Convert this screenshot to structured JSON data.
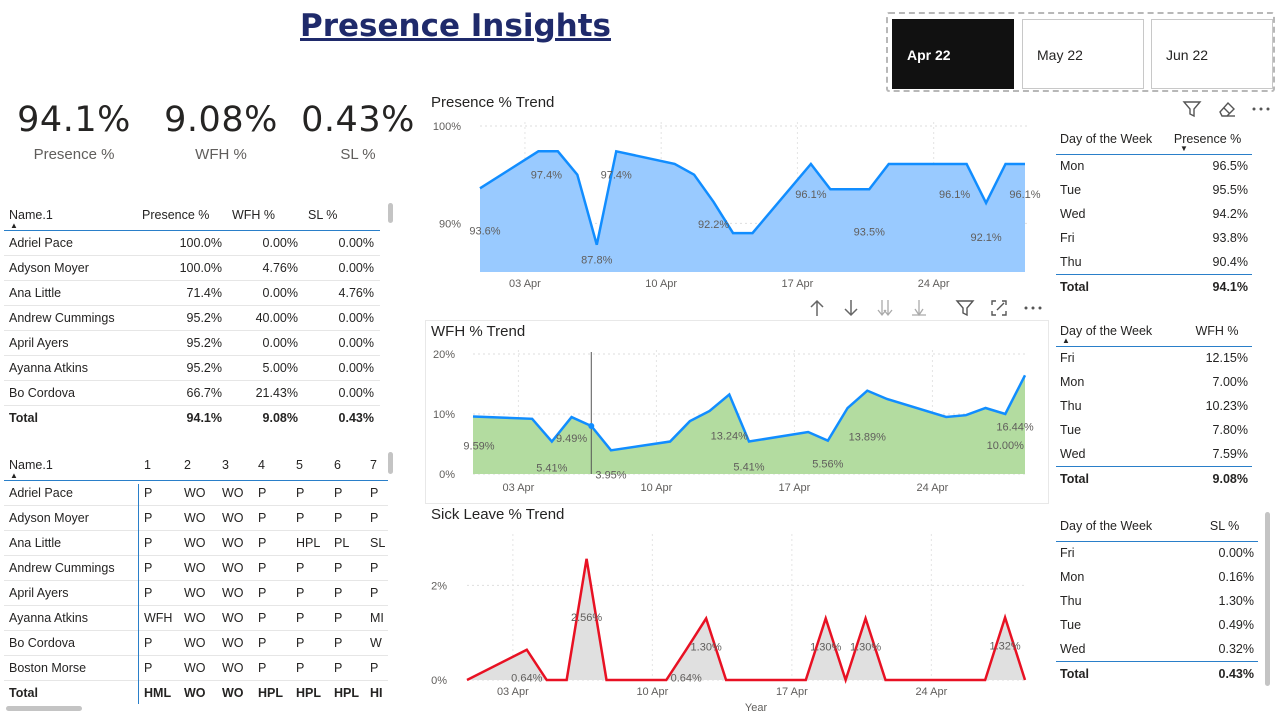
{
  "title": "Presence Insights",
  "slicer": {
    "items": [
      "Apr 22",
      "May 22",
      "Jun 22"
    ],
    "selected": "Apr 22"
  },
  "kpis": [
    {
      "value": "94.1%",
      "label": "Presence %"
    },
    {
      "value": "9.08%",
      "label": "WFH %"
    },
    {
      "value": "0.43%",
      "label": "SL %"
    }
  ],
  "employee_table": {
    "headers": [
      "Name.1",
      "Presence %",
      "WFH %",
      "SL %"
    ],
    "rows": [
      [
        "Adriel Pace",
        "100.0%",
        "0.00%",
        "0.00%"
      ],
      [
        "Adyson Moyer",
        "100.0%",
        "4.76%",
        "0.00%"
      ],
      [
        "Ana Little",
        "71.4%",
        "0.00%",
        "4.76%"
      ],
      [
        "Andrew Cummings",
        "95.2%",
        "40.00%",
        "0.00%"
      ],
      [
        "April Ayers",
        "95.2%",
        "0.00%",
        "0.00%"
      ],
      [
        "Ayanna Atkins",
        "95.2%",
        "5.00%",
        "0.00%"
      ],
      [
        "Bo Cordova",
        "66.7%",
        "21.43%",
        "0.00%"
      ]
    ],
    "total": [
      "Total",
      "94.1%",
      "9.08%",
      "0.43%"
    ]
  },
  "matrix_table": {
    "headers": [
      "Name.1",
      "1",
      "2",
      "3",
      "4",
      "5",
      "6",
      "7"
    ],
    "rows": [
      [
        "Adriel Pace",
        "P",
        "WO",
        "WO",
        "P",
        "P",
        "P",
        "P"
      ],
      [
        "Adyson Moyer",
        "P",
        "WO",
        "WO",
        "P",
        "P",
        "P",
        "P"
      ],
      [
        "Ana Little",
        "P",
        "WO",
        "WO",
        "P",
        "HPL",
        "PL",
        "SL"
      ],
      [
        "Andrew Cummings",
        "P",
        "WO",
        "WO",
        "P",
        "P",
        "P",
        "P"
      ],
      [
        "April Ayers",
        "P",
        "WO",
        "WO",
        "P",
        "P",
        "P",
        "P"
      ],
      [
        "Ayanna Atkins",
        "WFH",
        "WO",
        "WO",
        "P",
        "P",
        "P",
        "MI"
      ],
      [
        "Bo Cordova",
        "P",
        "WO",
        "WO",
        "P",
        "P",
        "P",
        "W"
      ],
      [
        "Boston Morse",
        "P",
        "WO",
        "WO",
        "P",
        "P",
        "P",
        "P"
      ]
    ],
    "total": [
      "Total",
      "HML",
      "WO",
      "WO",
      "HPL",
      "HPL",
      "HPL",
      "HI"
    ]
  },
  "presence_trend": {
    "title": "Presence % Trend",
    "y_ticks": [
      "100%",
      "90%"
    ],
    "x_ticks": [
      "03 Apr",
      "10 Apr",
      "17 Apr",
      "24 Apr"
    ],
    "labels": [
      "93.6%",
      "97.4%",
      "97.4%",
      "87.8%",
      "92.2%",
      "96.1%",
      "93.5%",
      "96.1%",
      "92.1%",
      "96.1%"
    ]
  },
  "wfh_trend": {
    "title": "WFH % Trend",
    "y_ticks": [
      "20%",
      "10%",
      "0%"
    ],
    "x_ticks": [
      "03 Apr",
      "10 Apr",
      "17 Apr",
      "24 Apr"
    ],
    "labels": [
      "9.59%",
      "5.41%",
      "9.49%",
      "3.95%",
      "13.24%",
      "5.41%",
      "5.56%",
      "13.89%",
      "10.00%",
      "16.44%"
    ]
  },
  "sl_trend": {
    "title": "Sick Leave % Trend",
    "y_ticks": [
      "2%",
      "0%"
    ],
    "x_ticks": [
      "03 Apr",
      "10 Apr",
      "17 Apr",
      "24 Apr"
    ],
    "x_axis_label": "Year",
    "labels": [
      "0.64%",
      "2.56%",
      "0.64%",
      "1.30%",
      "1.30%",
      "1.30%",
      "1.32%"
    ]
  },
  "presence_by_day": {
    "headers": [
      "Day of the Week",
      "Presence %"
    ],
    "rows": [
      [
        "Mon",
        "96.5%"
      ],
      [
        "Tue",
        "95.5%"
      ],
      [
        "Wed",
        "94.2%"
      ],
      [
        "Fri",
        "93.8%"
      ],
      [
        "Thu",
        "90.4%"
      ]
    ],
    "total": [
      "Total",
      "94.1%"
    ]
  },
  "wfh_by_day": {
    "headers": [
      "Day of the Week",
      "WFH %"
    ],
    "rows": [
      [
        "Fri",
        "12.15%"
      ],
      [
        "Mon",
        "7.00%"
      ],
      [
        "Thu",
        "10.23%"
      ],
      [
        "Tue",
        "7.80%"
      ],
      [
        "Wed",
        "7.59%"
      ]
    ],
    "total": [
      "Total",
      "9.08%"
    ]
  },
  "sl_by_day": {
    "headers": [
      "Day of the Week",
      "SL %"
    ],
    "rows": [
      [
        "Fri",
        "0.00%"
      ],
      [
        "Mon",
        "0.16%"
      ],
      [
        "Thu",
        "1.30%"
      ],
      [
        "Tue",
        "0.49%"
      ],
      [
        "Wed",
        "0.32%"
      ]
    ],
    "total": [
      "Total",
      "0.43%"
    ]
  },
  "chart_data": [
    {
      "type": "area",
      "title": "Presence % Trend",
      "xlabel": "",
      "ylabel": "",
      "x": [
        "2022-04-01",
        "2022-04-04",
        "2022-04-05",
        "2022-04-06",
        "2022-04-07",
        "2022-04-08",
        "2022-04-11",
        "2022-04-12",
        "2022-04-13",
        "2022-04-14",
        "2022-04-15",
        "2022-04-18",
        "2022-04-19",
        "2022-04-20",
        "2022-04-21",
        "2022-04-22",
        "2022-04-25",
        "2022-04-26",
        "2022-04-27",
        "2022-04-28",
        "2022-04-29"
      ],
      "values": [
        93.6,
        97.4,
        97.4,
        95.0,
        87.8,
        97.4,
        96.1,
        95.0,
        92.2,
        89.0,
        89.0,
        96.1,
        93.5,
        93.5,
        93.5,
        96.1,
        96.1,
        96.1,
        92.1,
        96.1,
        96.1
      ],
      "ylim": [
        85,
        100
      ]
    },
    {
      "type": "area",
      "title": "WFH % Trend",
      "xlabel": "",
      "ylabel": "",
      "x": [
        "2022-04-01",
        "2022-04-04",
        "2022-04-05",
        "2022-04-06",
        "2022-04-07",
        "2022-04-08",
        "2022-04-11",
        "2022-04-12",
        "2022-04-13",
        "2022-04-14",
        "2022-04-15",
        "2022-04-18",
        "2022-04-19",
        "2022-04-20",
        "2022-04-21",
        "2022-04-22",
        "2022-04-25",
        "2022-04-26",
        "2022-04-27",
        "2022-04-28",
        "2022-04-29"
      ],
      "values": [
        9.59,
        9.2,
        5.41,
        9.49,
        8.0,
        3.95,
        5.41,
        8.8,
        10.5,
        13.24,
        5.41,
        7.0,
        5.56,
        11.0,
        13.89,
        12.5,
        9.5,
        9.8,
        11.0,
        10.0,
        16.44
      ],
      "ylim": [
        0,
        20
      ]
    },
    {
      "type": "area",
      "title": "Sick Leave % Trend",
      "xlabel": "Year",
      "ylabel": "",
      "x": [
        "2022-04-01",
        "2022-04-04",
        "2022-04-05",
        "2022-04-06",
        "2022-04-07",
        "2022-04-08",
        "2022-04-11",
        "2022-04-12",
        "2022-04-13",
        "2022-04-14",
        "2022-04-15",
        "2022-04-18",
        "2022-04-19",
        "2022-04-20",
        "2022-04-21",
        "2022-04-22",
        "2022-04-25",
        "2022-04-26",
        "2022-04-27",
        "2022-04-28",
        "2022-04-29"
      ],
      "values": [
        0,
        0.64,
        0,
        0,
        2.56,
        0,
        0,
        0.64,
        1.3,
        0,
        0,
        0,
        1.3,
        0,
        1.3,
        0,
        0,
        0,
        0,
        1.32,
        0
      ],
      "ylim": [
        0,
        3
      ]
    }
  ]
}
